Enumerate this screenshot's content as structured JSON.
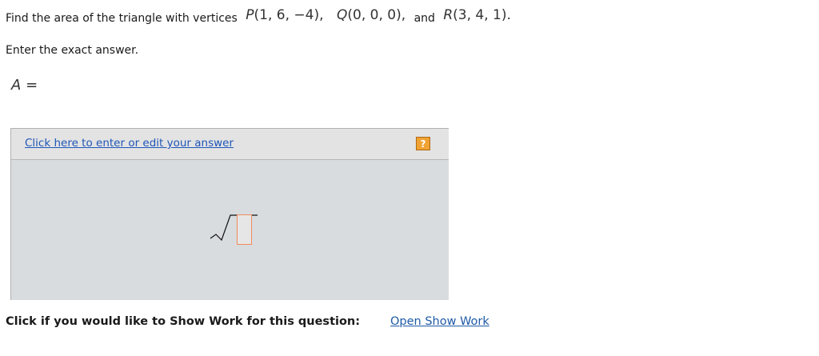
{
  "question": {
    "prefix": "Find the area of the triangle with vertices",
    "p_name": "P",
    "p_coords": "(1, 6, −4),",
    "q_name": "Q",
    "q_coords": "(0, 0, 0),",
    "and_word": "and",
    "r_name": "R",
    "r_coords": "(3, 4, 1)."
  },
  "instruction": "Enter the exact answer.",
  "answer": {
    "variable": "A",
    "equals": "="
  },
  "answer_box": {
    "edit_link": "Click here to enter or edit your answer",
    "help_label": "?",
    "template_icon": "square-root-template-icon"
  },
  "show_work": {
    "prompt": "Click if you would like to Show Work for this question:",
    "link": "Open Show Work"
  },
  "colors": {
    "link": "#1f56b7",
    "help_button": "#f0a233",
    "answer_panel": "#d9dcdf",
    "input_border": "#f08a5a"
  }
}
